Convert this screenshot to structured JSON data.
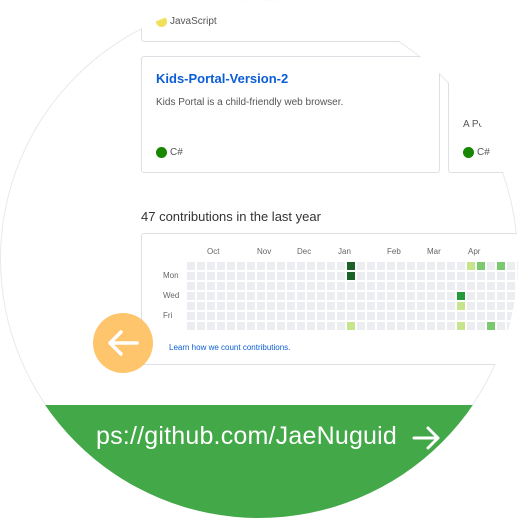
{
  "top_card": {
    "language": "JavaScript",
    "language_color": "#f1e05a"
  },
  "repo_card": {
    "title": "Kids-Portal-Version-2",
    "description": "Kids Portal is a child-friendly web browser.",
    "language": "C#",
    "language_color": "#178600"
  },
  "side_card": {
    "description_fragment": "A Po",
    "language": "C#",
    "language_color": "#178600"
  },
  "contributions": {
    "title": "47 contributions in the last year",
    "months": [
      "Oct",
      "Nov",
      "Dec",
      "Jan",
      "Feb",
      "Mar",
      "Apr"
    ],
    "days": [
      "Mon",
      "Wed",
      "Fri"
    ],
    "learn_link": "Learn how we count contributions.",
    "colors": {
      "empty": "#ebedf0",
      "l1": "#c6e48b",
      "l2": "#7bc96f",
      "l3": "#239a3b",
      "l4": "#196127"
    },
    "highlighted_cells": [
      {
        "week": 16,
        "day": 0,
        "level": "l4"
      },
      {
        "week": 16,
        "day": 1,
        "level": "l4"
      },
      {
        "week": 16,
        "day": 6,
        "level": "l1"
      },
      {
        "week": 27,
        "day": 3,
        "level": "l3"
      },
      {
        "week": 27,
        "day": 4,
        "level": "l1"
      },
      {
        "week": 27,
        "day": 6,
        "level": "l1"
      },
      {
        "week": 28,
        "day": 0,
        "level": "l1"
      },
      {
        "week": 29,
        "day": 0,
        "level": "l2"
      },
      {
        "week": 30,
        "day": 6,
        "level": "l2"
      },
      {
        "week": 31,
        "day": 0,
        "level": "l2"
      }
    ]
  },
  "nav": {
    "back_icon": "arrow-left-icon",
    "url_text": "ps://github.com/JaeNuguid",
    "forward_icon": "arrow-right-icon",
    "accent_color": "#43a848"
  }
}
